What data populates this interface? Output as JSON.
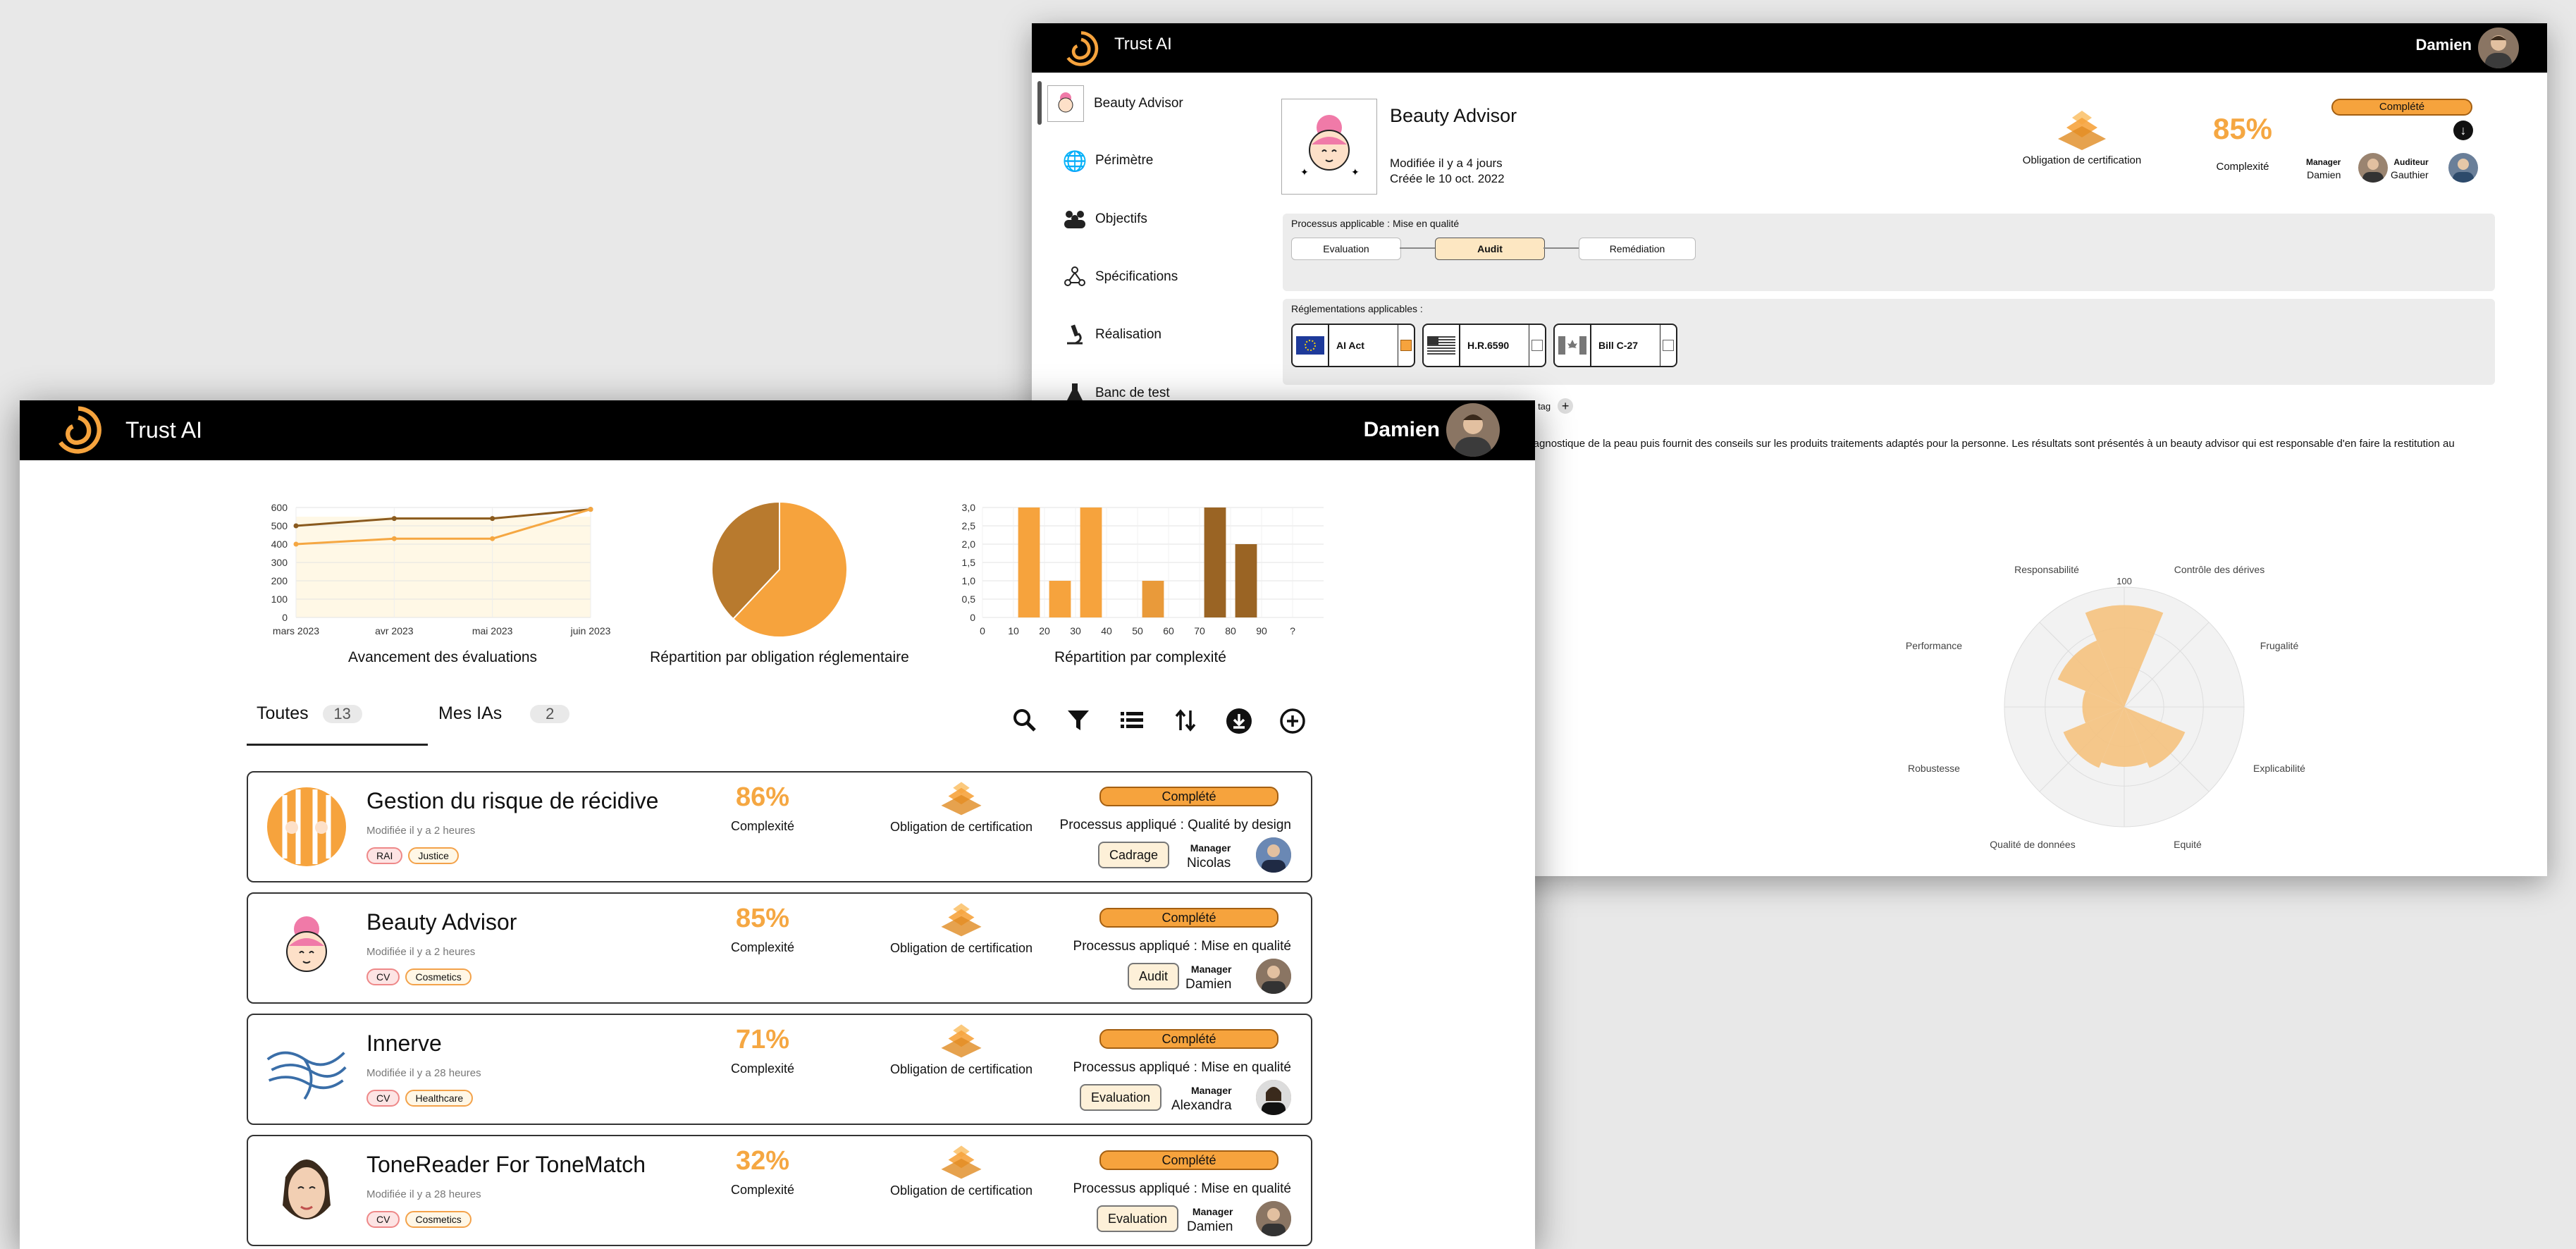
{
  "back_window": {
    "app_title": "Trust AI",
    "user_name": "Damien",
    "sidebar": {
      "items": [
        {
          "label": "Beauty Advisor",
          "icon": "beauty-advisor-thumbnail"
        },
        {
          "label": "Périmètre",
          "icon": "globe-icon"
        },
        {
          "label": "Objectifs",
          "icon": "people-icon"
        },
        {
          "label": "Spécifications",
          "icon": "nodes-icon"
        },
        {
          "label": "Réalisation",
          "icon": "microscope-icon"
        },
        {
          "label": "Banc de test",
          "icon": "flask-icon"
        }
      ]
    },
    "header": {
      "name": "Beauty Advisor",
      "modified": "Modifiée il y a 4 jours",
      "created": "Créée le 10 oct. 2022",
      "certification_label": "Obligation de certification",
      "complexity_value": "85%",
      "complexity_label": "Complexité",
      "status": "Complété",
      "manager_role": "Manager",
      "manager_name": "Damien",
      "auditor_role": "Auditeur",
      "auditor_name": "Gauthier"
    },
    "process_panel": {
      "title": "Processus applicable : Mise en qualité",
      "steps": [
        {
          "label": "Evaluation",
          "active": false
        },
        {
          "label": "Audit",
          "active": true
        },
        {
          "label": "Remédiation",
          "active": false
        }
      ]
    },
    "regulations_panel": {
      "title": "Réglementations applicables :",
      "items": [
        {
          "label": "AI Act",
          "flag": "eu-flag",
          "checked": true
        },
        {
          "label": "H.R.6590",
          "flag": "us-flag",
          "checked": false
        },
        {
          "label": "Bill C-27",
          "flag": "canada-flag",
          "checked": false
        }
      ]
    },
    "add_tag_label": "un tag",
    "description_line1": "diagnostique de la peau puis fournit des conseils sur les produits traitements adaptés pour la personne. Les résultats sont présentés à un beauty advisor qui est responsable d'en faire la restitution au",
    "radar": {
      "axis_labels": [
        "Responsabilité",
        "Contrôle des dérives",
        "Frugalité",
        "Explicabilité",
        "Equité",
        "Qualité de données",
        "Robustesse",
        "Performance"
      ],
      "max_tick": "100",
      "values": [
        0.85,
        0.0,
        0.0,
        0.55,
        0.5,
        0.55,
        0.35,
        0.6
      ],
      "fill_color": "#f5c27e"
    }
  },
  "front_window": {
    "app_title": "Trust AI",
    "user_name": "Damien",
    "captions": {
      "line": "Avancement des évaluations",
      "pie": "Répartition par obligation réglementaire",
      "bar": "Répartition par complexité"
    },
    "tabs": [
      {
        "label": "Toutes",
        "count": "13"
      },
      {
        "label": "Mes IAs",
        "count": "2"
      }
    ],
    "toolbar_icons": [
      "search-icon",
      "filter-icon",
      "list-view-icon",
      "sort-icon",
      "download-icon",
      "add-icon"
    ],
    "cards": [
      {
        "name": "Gestion du risque de récidive",
        "modified": "Modifiée il y a 2 heures",
        "tags": [
          {
            "label": "RAI",
            "style": "pink"
          },
          {
            "label": "Justice",
            "style": "orange"
          }
        ],
        "complexity": "86%",
        "complexity_label": "Complexité",
        "certification": "Obligation de certification",
        "status": "Complété",
        "process": "Processus appliqué : Qualité by design",
        "phase": "Cadrage",
        "manager_role": "Manager",
        "manager": "Nicolas"
      },
      {
        "name": "Beauty Advisor",
        "modified": "Modifiée il y a 2 heures",
        "tags": [
          {
            "label": "CV",
            "style": "pink"
          },
          {
            "label": "Cosmetics",
            "style": "orange"
          }
        ],
        "complexity": "85%",
        "complexity_label": "Complexité",
        "certification": "Obligation de certification",
        "status": "Complété",
        "process": "Processus appliqué : Mise en qualité",
        "phase": "Audit",
        "manager_role": "Manager",
        "manager": "Damien"
      },
      {
        "name": "Innerve",
        "modified": "Modifiée il y a 28 heures",
        "tags": [
          {
            "label": "CV",
            "style": "pink"
          },
          {
            "label": "Healthcare",
            "style": "orange"
          }
        ],
        "complexity": "71%",
        "complexity_label": "Complexité",
        "certification": "Obligation de certification",
        "status": "Complété",
        "process": "Processus appliqué : Mise en qualité",
        "phase": "Evaluation",
        "manager_role": "Manager",
        "manager": "Alexandra"
      },
      {
        "name": "ToneReader For ToneMatch",
        "modified": "Modifiée il y a 28 heures",
        "tags": [
          {
            "label": "CV",
            "style": "pink"
          },
          {
            "label": "Cosmetics",
            "style": "orange"
          }
        ],
        "complexity": "32%",
        "complexity_label": "Complexité",
        "certification": "Obligation de certification",
        "status": "Complété",
        "process": "Processus appliqué : Mise en qualité",
        "phase": "Evaluation",
        "manager_role": "Manager",
        "manager": "Damien"
      }
    ]
  },
  "chart_data": [
    {
      "type": "line",
      "x": [
        "mars 2023",
        "avr 2023",
        "mai 2023",
        "juin 2023"
      ],
      "ylim": [
        0,
        600
      ],
      "yticks": [
        0,
        100,
        200,
        300,
        400,
        500,
        600
      ],
      "series": [
        {
          "values": [
            500,
            540,
            540,
            590
          ],
          "color": "#8a5a1e"
        },
        {
          "values": [
            400,
            430,
            430,
            590
          ],
          "color": "#f5a742"
        }
      ],
      "title": "",
      "xlabel": "",
      "ylabel": ""
    },
    {
      "type": "pie",
      "values": [
        62,
        38
      ],
      "colors": [
        "#f6a33d",
        "#b87a2e"
      ]
    },
    {
      "type": "bar",
      "categories": [
        "0",
        "10",
        "20",
        "30",
        "40",
        "50",
        "60",
        "70",
        "80",
        "90",
        "?"
      ],
      "values": [
        0,
        3,
        1,
        3,
        0,
        1,
        0,
        3,
        2,
        0,
        0
      ],
      "colors": [
        "#f6a33d",
        "#f6a33d",
        "#f6a33d",
        "#f6a33d",
        "#f6a33d",
        "#e99a3a",
        "#c98433",
        "#9a6424",
        "#9a6424",
        "#9a6424",
        "#9a6424"
      ],
      "ylim": [
        0,
        3
      ],
      "yticks": [
        "0",
        "0,5",
        "1,0",
        "1,5",
        "2,0",
        "2,5",
        "3,0"
      ]
    }
  ]
}
